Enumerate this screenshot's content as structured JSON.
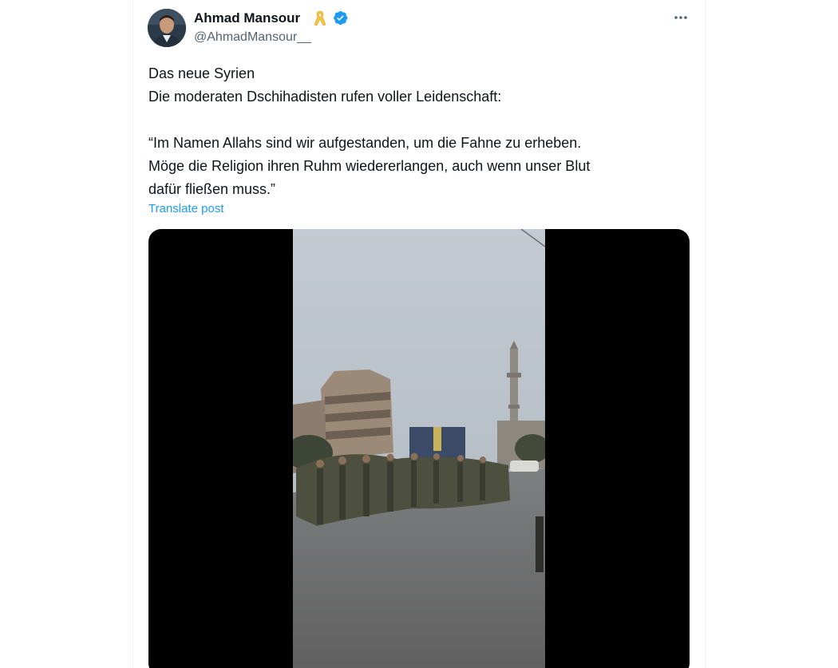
{
  "author": {
    "name": "Ahmad Mansour",
    "handle": "@AhmadMansour__",
    "verified": true,
    "badge_icon": "yellow-ribbon-icon"
  },
  "post": {
    "lines": [
      "Das neue Syrien",
      "Die moderaten Dschihadisten rufen voller Leidenschaft:",
      "",
      "“Im Namen Allahs sind wir aufgestanden, um die Fahne zu erheben.",
      "Möge die Religion ihren Ruhm wiedererlangen, auch wenn unser Blut",
      "dafür fließen muss.”"
    ],
    "translate_label": "Translate post"
  },
  "colors": {
    "text_primary": "#0f1419",
    "text_secondary": "#536471",
    "link": "#1d9bf0",
    "verified": "#1d9bf0",
    "ribbon": "#f5c542"
  }
}
